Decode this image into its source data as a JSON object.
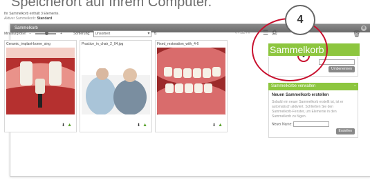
{
  "caption": "Speicherort auf Ihrem Computer.",
  "window": {
    "title": "Sammelkorb",
    "close": "⊗",
    "info_line1": "Ihr Sammelkorb enthält 3 Elemente.",
    "info_line2_prefix": "Aktiver Sammelkorb:",
    "info_line2_value": "Standard",
    "thumb_label": "Miniaturgröße:",
    "minus": "−",
    "plus": "+",
    "sort_label": "Sortierung:",
    "sort_value": "Unsortiert",
    "sort_arrow": "⇅",
    "pager": "« ‹ 1/1 › »",
    "files": [
      "Ceramic_implant-borne_sing",
      "Practice_in_chair_2_04.jpg",
      "Fixed_restoration_with_4-6"
    ],
    "icons": [
      "list-icon",
      "print-icon",
      "download-icon",
      "trash-icon"
    ]
  },
  "badge_number": "4",
  "panel": {
    "title": "Sammelkorb",
    "header2": "Sammelkörbe verwalten",
    "rename_button": "Umbenennen",
    "new_heading": "Neuen Sammelkorb erstellen",
    "new_text": "Sobald ein neuer Sammelkorb erstellt ist, ist er automatisch aktiviert. Schließen Sie den Sammelkorb-Fenster, um Elemente in den Sammelkorb zu fügen.",
    "name_label": "Neuer Name:",
    "create_button": "Erstellen"
  },
  "colors": {
    "accent": "#8dc63f",
    "highlight": "#c8102e"
  }
}
